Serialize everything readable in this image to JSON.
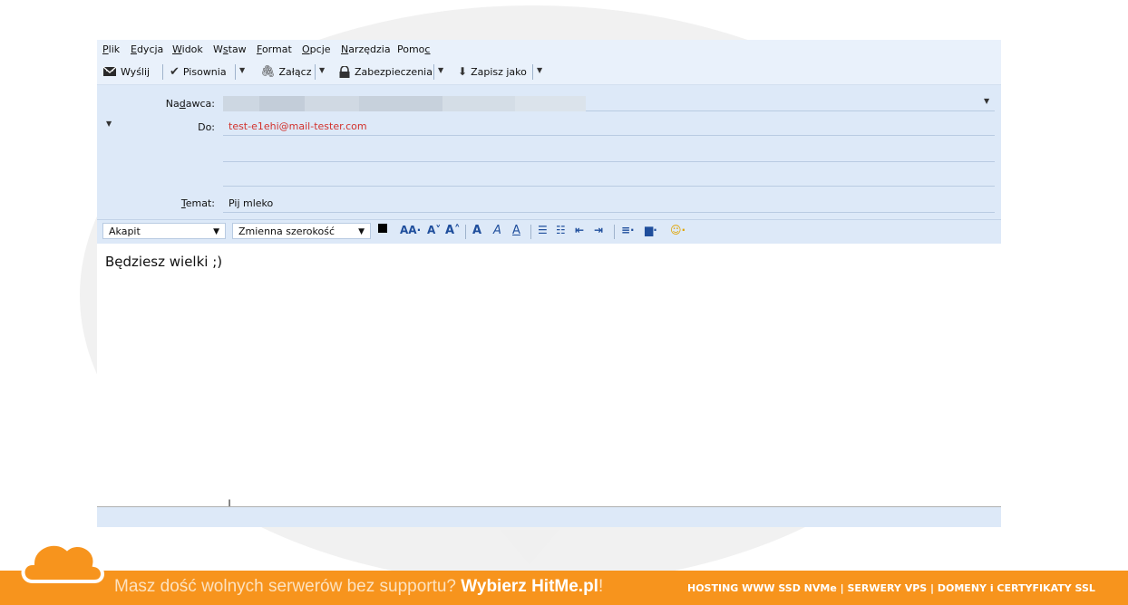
{
  "menu": [
    {
      "accel": "P",
      "rest": "lik"
    },
    {
      "accel": "E",
      "rest": "dycja"
    },
    {
      "accel": "W",
      "rest": "idok"
    },
    {
      "pre": "W",
      "accel": "s",
      "rest": "taw"
    },
    {
      "accel": "F",
      "rest": "ormat"
    },
    {
      "accel": "O",
      "rest": "pcje"
    },
    {
      "accel": "N",
      "rest": "arzędzia"
    },
    {
      "pre": "Pomo",
      "accel": "c",
      "rest": ""
    }
  ],
  "toolbar": {
    "send": "Wyślij",
    "spelling": "Pisownia",
    "attach": "Załącz",
    "security": "Zabezpieczenia",
    "save_as": "Zapisz jako"
  },
  "header": {
    "sender_label_pre": "Na",
    "sender_label_accel": "d",
    "sender_label_rest": "awca:",
    "to_label": "Do:",
    "to_value": "test-e1ehi@mail-tester.com",
    "subject_label_accel": "T",
    "subject_label_rest": "emat:",
    "subject_value": "Pij mleko"
  },
  "format": {
    "paragraph": "Akapit",
    "font": "Zmienna szerokość"
  },
  "body": {
    "text": "Będziesz wielki ;)"
  },
  "footer": {
    "promo_text": "Masz dość wolnych serwerów bez supportu? ",
    "promo_bold": "Wybierz HitMe.pl",
    "promo_end": "!",
    "services": "HOSTING WWW SSD NVMe | SERWERY VPS | DOMENY i CERTYFIKATY SSL"
  },
  "colors": {
    "accent_orange": "#f7941d",
    "header_blue": "#dde9f8",
    "recipient_red": "#d2322d"
  }
}
